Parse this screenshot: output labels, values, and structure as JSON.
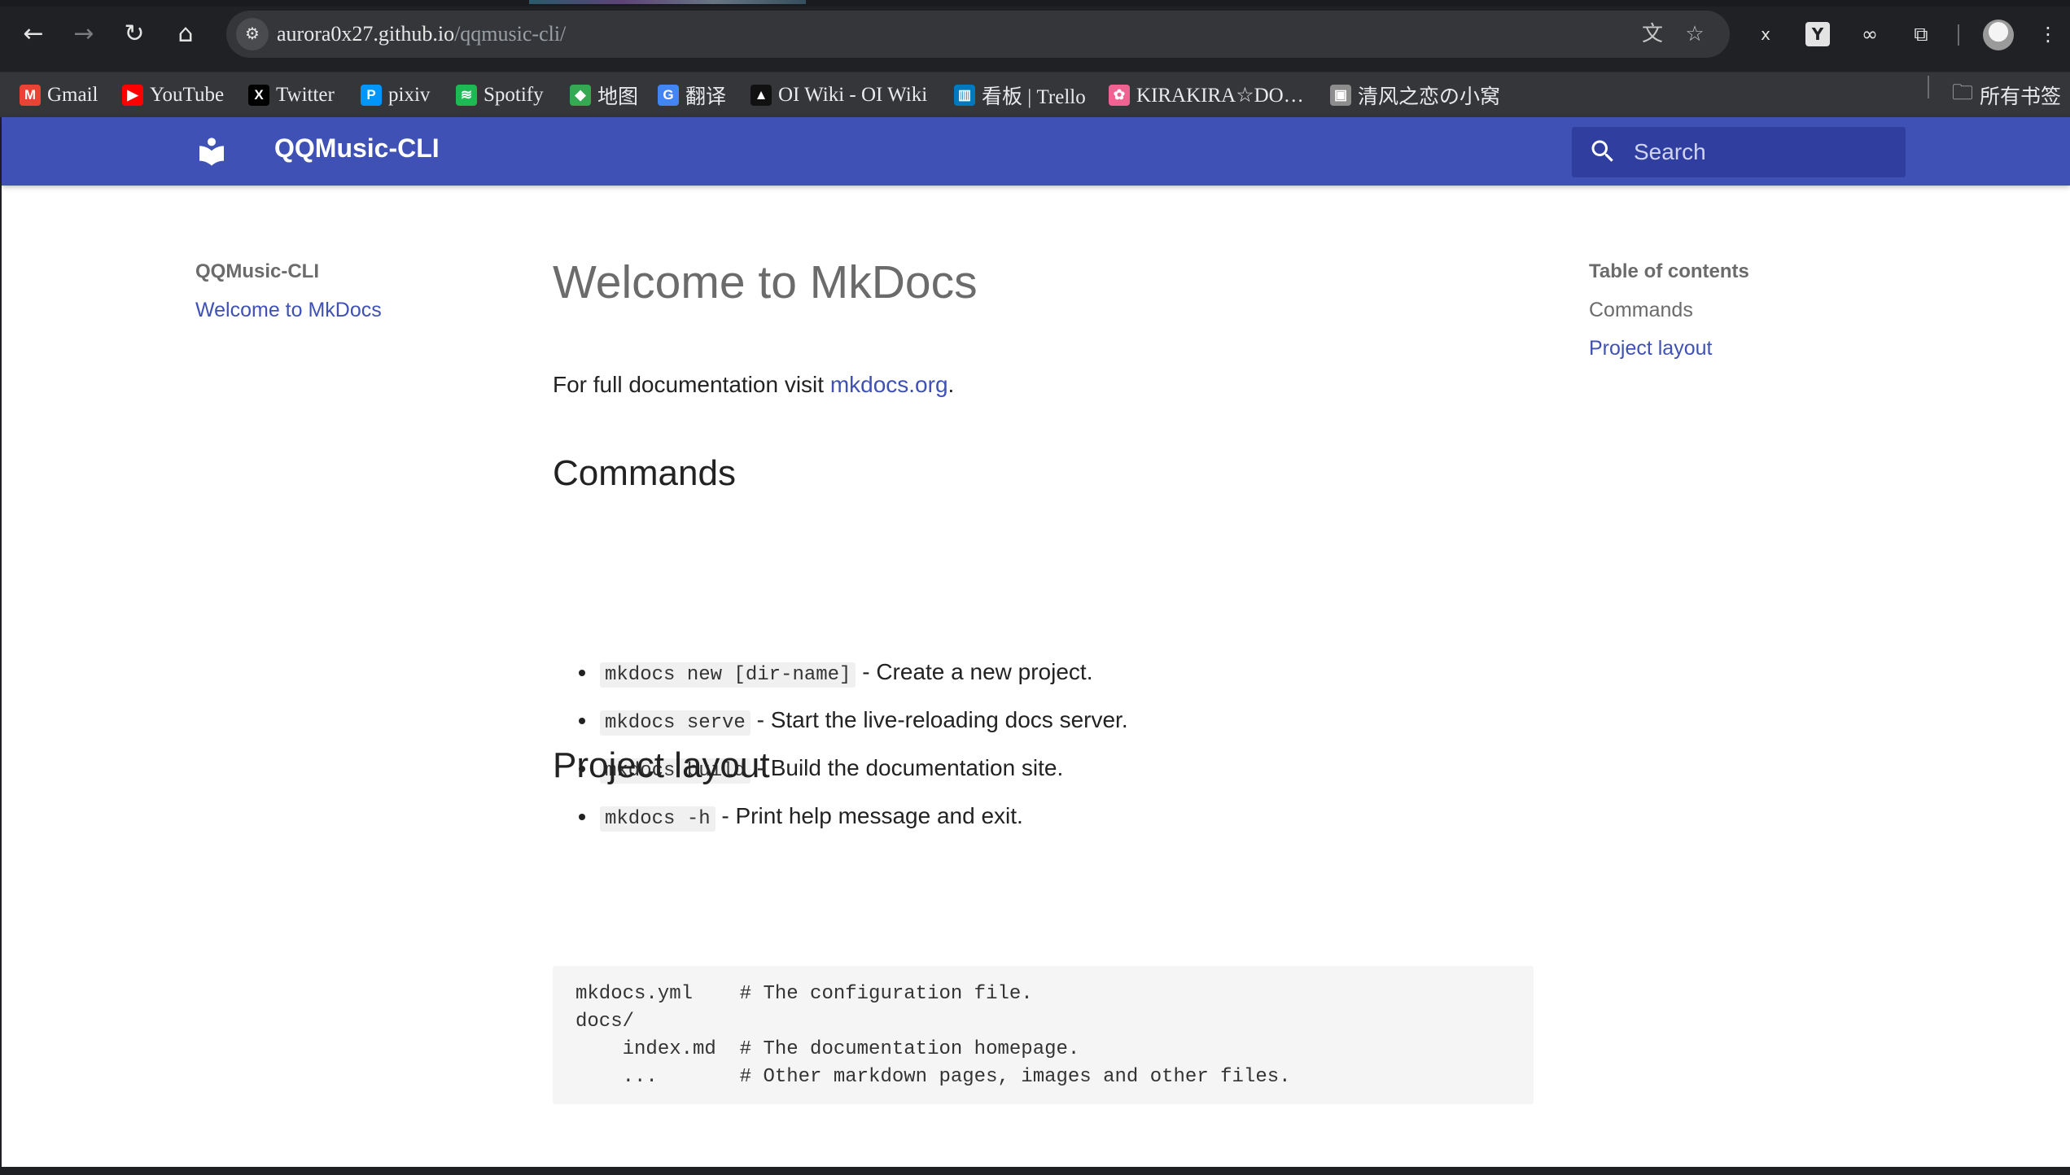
{
  "browser": {
    "url_host": "aurora0x27.github.io",
    "url_path": "/qqmusic-cli/",
    "bookmarks": [
      {
        "label": "Gmail",
        "icon": "gmail-icon",
        "icon_text": "M",
        "color": "#ea4335"
      },
      {
        "label": "YouTube",
        "icon": "youtube-icon",
        "icon_text": "▶",
        "color": "#ff0000"
      },
      {
        "label": "Twitter",
        "icon": "x-icon",
        "icon_text": "X",
        "color": "#000000"
      },
      {
        "label": "pixiv",
        "icon": "pixiv-icon",
        "icon_text": "P",
        "color": "#0096fa"
      },
      {
        "label": "Spotify",
        "icon": "spotify-icon",
        "icon_text": "≋",
        "color": "#1db954"
      },
      {
        "label": "地图",
        "icon": "maps-icon",
        "icon_text": "◆",
        "color": "#34a853"
      },
      {
        "label": "翻译",
        "icon": "translate-icon",
        "icon_text": "G",
        "color": "#4285f4"
      },
      {
        "label": "OI Wiki - OI Wiki",
        "icon": "graduation-cap-icon",
        "icon_text": "▲",
        "color": "#111111"
      },
      {
        "label": "看板 | Trello",
        "icon": "trello-icon",
        "icon_text": "▥",
        "color": "#0079bf"
      },
      {
        "label": "KIRAKIRA☆DO…",
        "icon": "flower-icon",
        "icon_text": "✿",
        "color": "#f06292"
      },
      {
        "label": "清风之恋の小窝",
        "icon": "site-thumbnail-icon",
        "icon_text": "▣",
        "color": "#8d8d8d"
      }
    ],
    "all_bookmarks_label": "所有书签"
  },
  "site": {
    "title": "QQMusic-CLI",
    "search_placeholder": "Search",
    "accent": "#3f51b5"
  },
  "nav": {
    "title": "QQMusic-CLI",
    "items": [
      "Welcome to MkDocs"
    ]
  },
  "toc": {
    "title": "Table of contents",
    "items": [
      "Commands",
      "Project layout"
    ]
  },
  "content": {
    "h1": "Welcome to MkDocs",
    "intro_text": "For full documentation visit ",
    "intro_link": "mkdocs.org",
    "intro_end": ".",
    "commands_heading": "Commands",
    "commands": [
      {
        "code": "mkdocs new [dir-name]",
        "desc": " - Create a new project."
      },
      {
        "code": "mkdocs serve",
        "desc": " - Start the live-reloading docs server."
      },
      {
        "code": "mkdocs build",
        "desc": " - Build the documentation site."
      },
      {
        "code": "mkdocs -h",
        "desc": " - Print help message and exit."
      }
    ],
    "layout_heading": "Project layout",
    "layout_code": "mkdocs.yml    # The configuration file.\ndocs/\n    index.md  # The documentation homepage.\n    ...       # Other markdown pages, images and other files."
  }
}
